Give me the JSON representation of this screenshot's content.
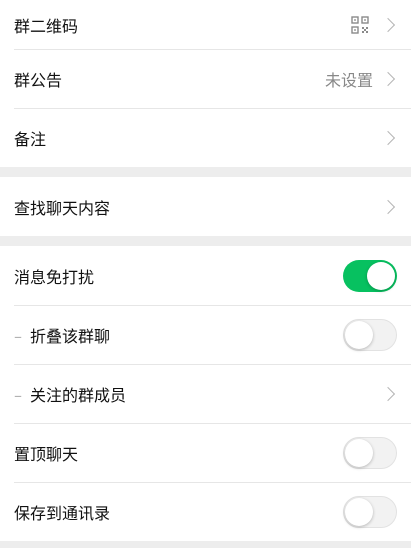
{
  "group_info": {
    "qr_code": {
      "label": "群二维码",
      "icon": "qr-code-icon"
    },
    "announcement": {
      "label": "群公告",
      "value": "未设置"
    },
    "remark": {
      "label": "备注"
    }
  },
  "search": {
    "find_chat": {
      "label": "查找聊天内容"
    }
  },
  "settings": {
    "mute": {
      "label": "消息免打扰",
      "enabled": true
    },
    "fold": {
      "prefix": "–",
      "label": "折叠该群聊",
      "enabled": false
    },
    "followed_members": {
      "prefix": "–",
      "label": "关注的群成员"
    },
    "pin": {
      "label": "置顶聊天",
      "enabled": false
    },
    "save_contacts": {
      "label": "保存到通讯录",
      "enabled": false
    }
  },
  "colors": {
    "toggle_on": "#07c160",
    "background": "#ededed"
  }
}
